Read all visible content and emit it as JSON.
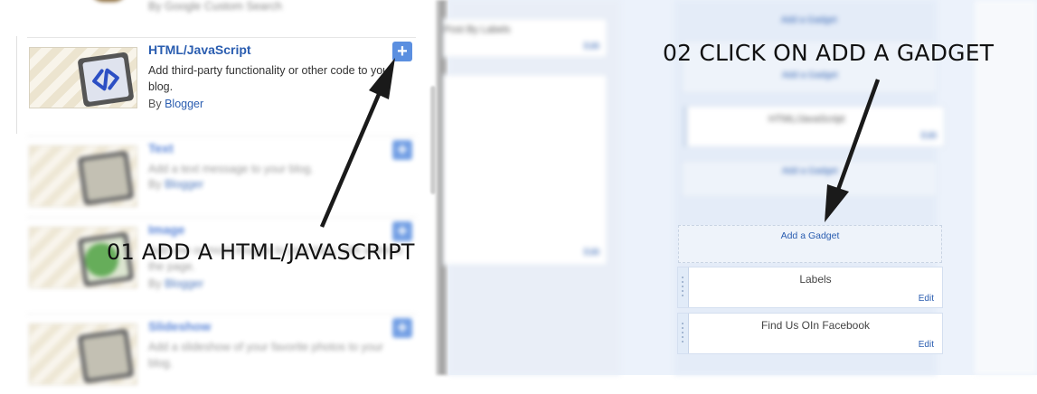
{
  "left_panel": {
    "top_fragment_by": "By Google Custom Search",
    "gadgets": [
      {
        "title": "HTML/JavaScript",
        "description": "Add third-party functionality or other code to your blog.",
        "by_prefix": "By",
        "author": "Blogger"
      },
      {
        "title": "Text",
        "description": "Add a text message to your blog.",
        "by_prefix": "By",
        "author": "Blogger"
      },
      {
        "title": "Image",
        "description": "Add one or more images to your blog, with a link to the page.",
        "by_prefix": "By",
        "author": "Blogger"
      },
      {
        "title": "Slideshow",
        "description": "Add a slideshow of your favorite photos to your blog.",
        "by_prefix": "",
        "author": ""
      }
    ],
    "add_symbol": "+"
  },
  "layout": {
    "post_by_labels": "Post By Labels",
    "edit": "Edit",
    "add_gadget": "Add a Gadget",
    "html_javascript": "HTML/JavaScript",
    "widgets": [
      {
        "title": "Labels",
        "edit": "Edit"
      },
      {
        "title": "Find Us OIn Facebook",
        "edit": "Edit"
      }
    ]
  },
  "annotations": {
    "step1": "01  ADD A HTML/JAVASCRIPT",
    "step2": "02   CLICK ON ADD A GADGET"
  },
  "colors": {
    "link": "#2a5db0",
    "add_button": "#5b8fe0",
    "layout_bg": "#ecf2fb"
  }
}
